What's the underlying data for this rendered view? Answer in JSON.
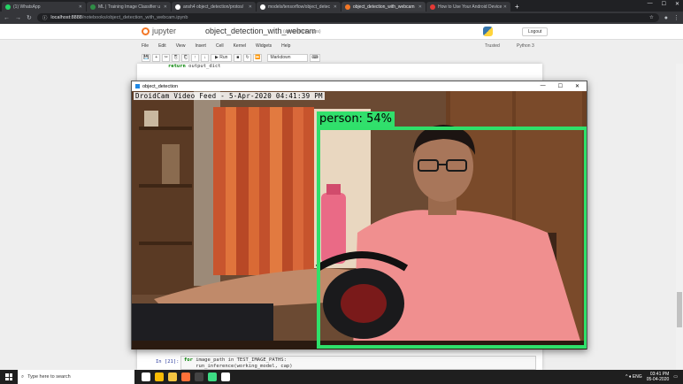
{
  "browser": {
    "tabs": [
      {
        "label": "(1) WhatsApp",
        "icon": "whatsapp-icon",
        "color": "#25d366",
        "active": false
      },
      {
        "label": "ML | Training Image Classifier u",
        "icon": "gfg-icon",
        "color": "#2f8d46",
        "active": false
      },
      {
        "label": "ansh4 object_detection/protos/",
        "icon": "github-icon",
        "color": "#ffffff",
        "active": false
      },
      {
        "label": "models/tensorflow/object_detec",
        "icon": "github-icon",
        "color": "#ffffff",
        "active": false
      },
      {
        "label": "object_detection_with_webcam",
        "icon": "jupyter-icon",
        "color": "#f37726",
        "active": true
      },
      {
        "label": "How to Use Your Android Device",
        "icon": "droidcam-icon",
        "color": "#e53935",
        "active": false
      }
    ],
    "new_tab": "+",
    "window_controls": [
      "—",
      "☐",
      "✕"
    ],
    "nav": {
      "back": "←",
      "forward": "→",
      "reload": "↻"
    },
    "url_host": "localhost:8888",
    "url_path": "/notebooks/object_detection_with_webcam.ipynb",
    "info_icon": "ⓘ"
  },
  "jupyter": {
    "logo_text": "jupyter",
    "notebook_title": "object_detection_with_webcam",
    "saved_status": "(unsaved changes)",
    "logout_label": "Logout",
    "menu": [
      "File",
      "Edit",
      "View",
      "Insert",
      "Cell",
      "Kernel",
      "Widgets",
      "Help"
    ],
    "trusted": "Trusted",
    "kernel": "Python 3",
    "toolbar": {
      "buttons": [
        "💾",
        "+",
        "✂",
        "⎘",
        "⎗",
        "↑",
        "↓"
      ],
      "run_label": "▶ Run",
      "stop": "■",
      "restart": "↻",
      "fastforward": "⏩",
      "cell_type": "Markdown",
      "keyboard": "⌨"
    },
    "code_above": {
      "keyword": "return",
      "rest": " output_dict"
    },
    "cell": {
      "prompt": "In [21]:",
      "line1_kw": "for",
      "line1_rest": " image_path in TEST_IMAGE_PATHS:",
      "line2": "    run_inference(working_model, cap)"
    }
  },
  "cv_window": {
    "title": "object_detection",
    "controls": [
      "—",
      "☐",
      "✕"
    ],
    "overlay_text": "DroidCam Video Feed - 5-Apr-2020 04:41:39 PM",
    "detection_label": "person: 54%",
    "detection_color": "#2fe06a"
  },
  "taskbar": {
    "search_placeholder": "Type here to search",
    "apps": [
      {
        "name": "task-view-icon",
        "color": "#ffffff"
      },
      {
        "name": "chrome-icon",
        "color": "#fbbc05"
      },
      {
        "name": "explorer-icon",
        "color": "#f4c542"
      },
      {
        "name": "firefox-icon",
        "color": "#ff7139"
      },
      {
        "name": "terminal-icon",
        "color": "#444444"
      },
      {
        "name": "app-green-icon",
        "color": "#3ddc84"
      },
      {
        "name": "notepad-icon",
        "color": "#ffffff"
      }
    ],
    "tray_text": "^ ♦ ENG",
    "time": "03:41 PM",
    "date": "05-04-2020"
  }
}
